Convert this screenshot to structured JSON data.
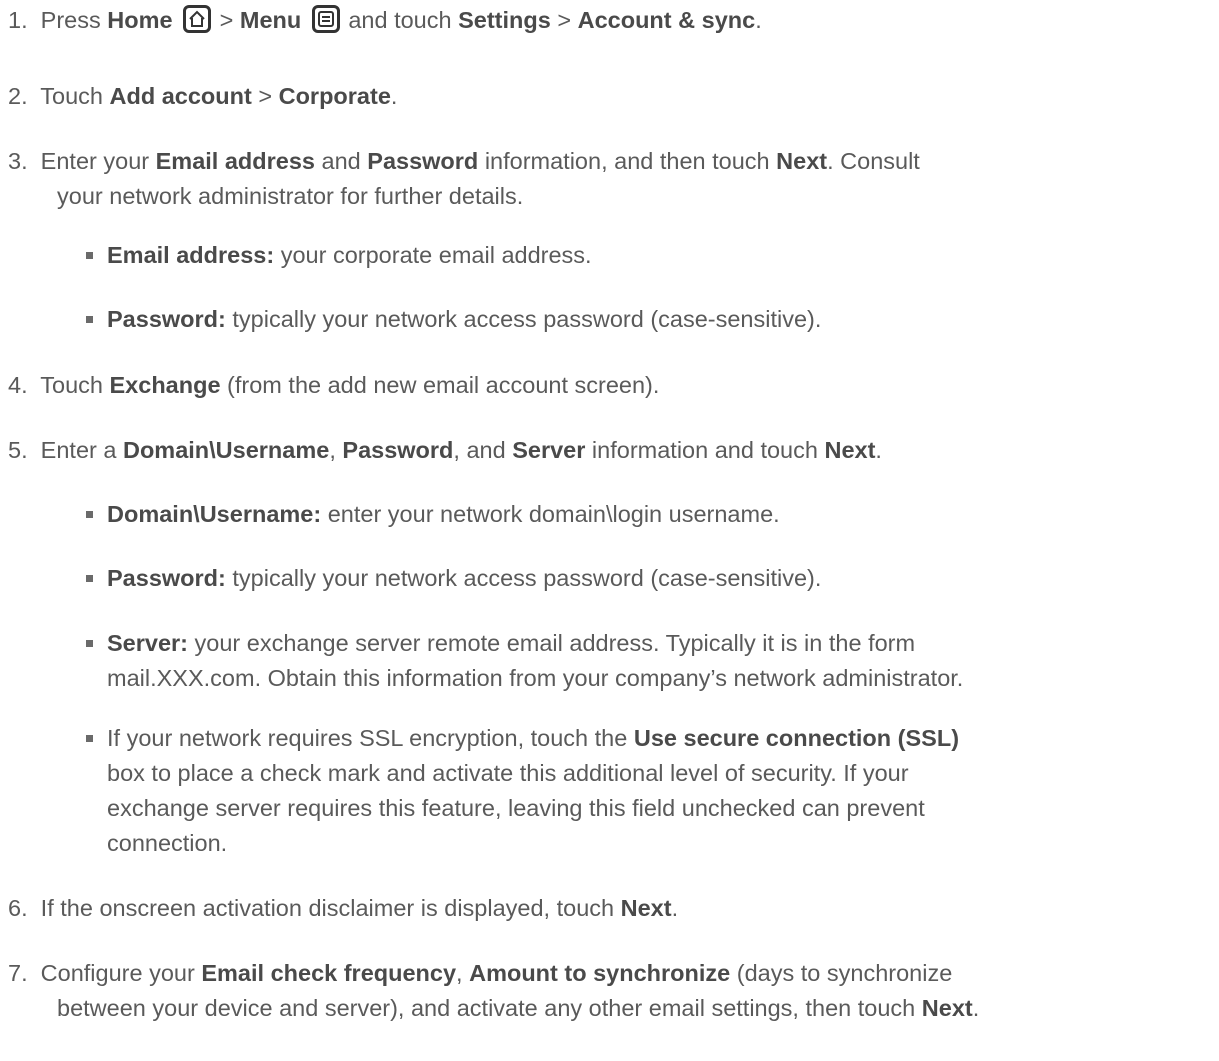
{
  "steps": [
    {
      "num": "1.",
      "t1": "Press ",
      "b1": "Home",
      "t2": " > ",
      "b2": "Menu",
      "t3": " and touch ",
      "b3": "Settings",
      "t4": " > ",
      "b4": "Account & sync",
      "t5": "."
    },
    {
      "num": "2.",
      "t1": "Touch ",
      "b1": "Add account",
      "t2": " > ",
      "b2": "Corporate",
      "t3": "."
    },
    {
      "num": "3.",
      "t1": "Enter your ",
      "b1": "Email address",
      "t2": " and ",
      "b2": "Password",
      "t3": " information, and then touch ",
      "b3": "Next",
      "t4": ". Consult",
      "line2": "your network administrator for further details."
    },
    {
      "num": "4.",
      "t1": "Touch ",
      "b1": "Exchange",
      "t2": " (from the add new email account screen)."
    },
    {
      "num": "5.",
      "t1": "Enter a ",
      "b1": "Domain\\Username",
      "t2": ", ",
      "b2": "Password",
      "t3": ", and ",
      "b3": "Server",
      "t4": " information and touch ",
      "b4": "Next",
      "t5": "."
    },
    {
      "num": "6.",
      "t1": "If the onscreen activation disclaimer is displayed, touch ",
      "b1": "Next",
      "t2": "."
    },
    {
      "num": "7.",
      "t1": "Configure your ",
      "b1": "Email check frequency",
      "t2": ", ",
      "b2": "Amount to synchronize",
      "t3": " (days to synchronize",
      "line2a": "between your device and server), and activate any other email settings, then touch ",
      "line2b": "Next",
      "line2c": "."
    }
  ],
  "bullets3": [
    {
      "b": "Email address:",
      "t": " your corporate email address."
    },
    {
      "b": "Password:",
      "t": " typically your network access password (case-sensitive)."
    }
  ],
  "bullets5": [
    {
      "b": "Domain\\Username:",
      "t": " enter your network domain\\login username."
    },
    {
      "b": "Password:",
      "t": " typically your network access password (case-sensitive)."
    },
    {
      "b": "Server:",
      "t": " your exchange server remote email address. Typically it is in the form",
      "l2": "mail.XXX.com. Obtain this information from your company’s network administrator."
    },
    {
      "t1": "If your network requires SSL encryption, touch the ",
      "b": "Use secure connection (SSL)",
      "l2": "box to place a check mark and activate this additional level of security. If your",
      "l3": "exchange server requires this feature, leaving this field unchecked can prevent",
      "l4": "connection."
    }
  ],
  "icons": {
    "home": "home-icon",
    "menu": "menu-icon"
  }
}
